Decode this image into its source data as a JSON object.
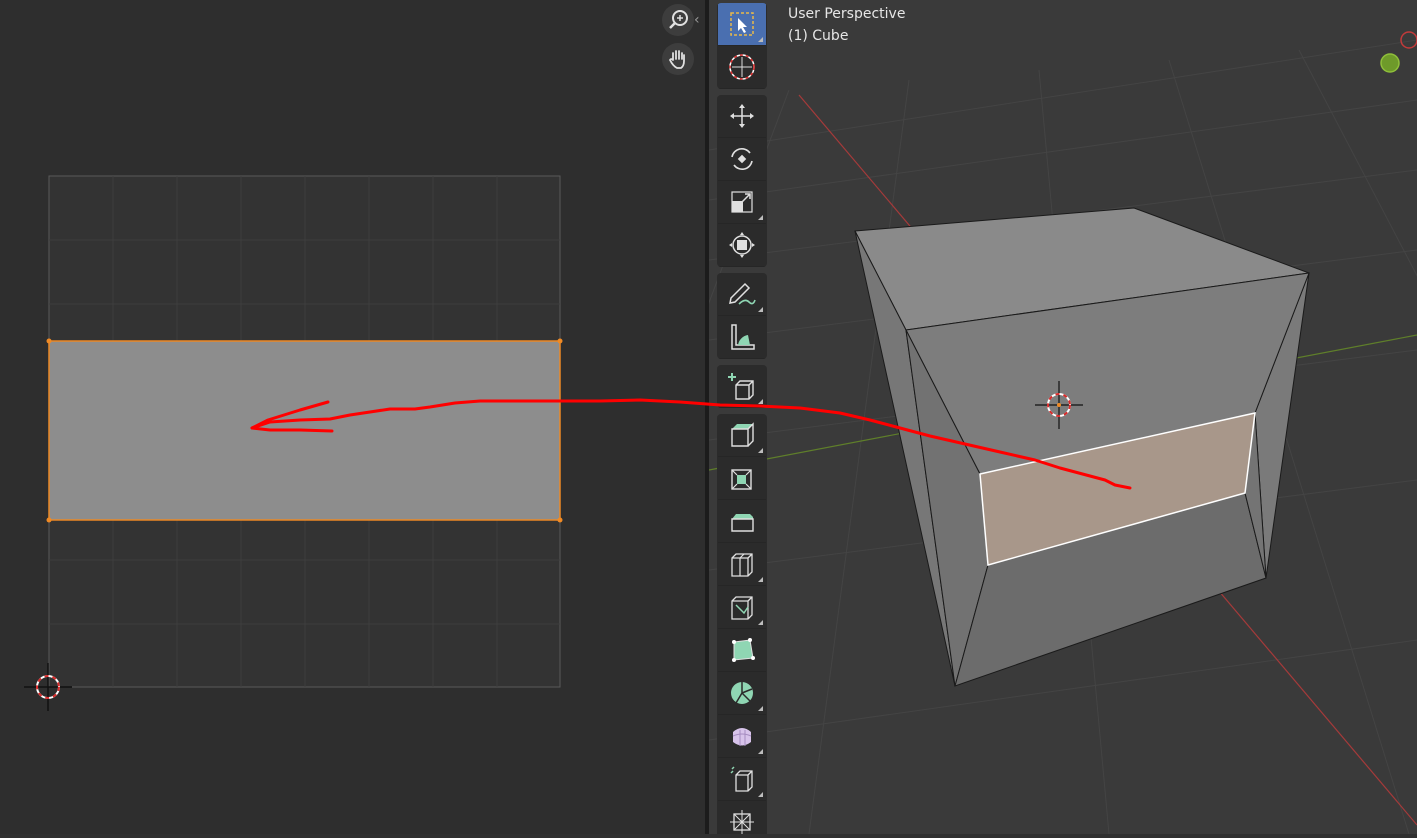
{
  "viewport": {
    "view_name": "User Perspective",
    "object_name": "(1) Cube"
  },
  "colors": {
    "uv_background": "#2e2e2e",
    "viewport_background": "#3a3a3a",
    "selection_orange": "#f08a24",
    "active_tool_blue": "#4a6fb0",
    "annotation_red": "#ff0000",
    "selected_face": "#a8978a"
  },
  "uv_editor": {
    "icons": [
      "zoom-icon",
      "hand-pan-icon",
      "collapse-arrow-icon",
      "2d-cursor-icon"
    ]
  },
  "toolbar": {
    "groups": [
      [
        "select-box-tool",
        "cursor-tool"
      ],
      [
        "move-tool",
        "rotate-tool",
        "scale-tool",
        "transform-tool"
      ],
      [
        "annotate-tool",
        "measure-tool"
      ],
      [
        "add-cube-tool"
      ],
      [
        "extrude-region-tool",
        "inset-faces-tool",
        "bevel-tool",
        "loop-cut-tool",
        "knife-tool",
        "poly-build-tool",
        "spin-tool",
        "smooth-tool",
        "edge-slide-tool",
        "shrink-fatten-tool"
      ]
    ]
  }
}
